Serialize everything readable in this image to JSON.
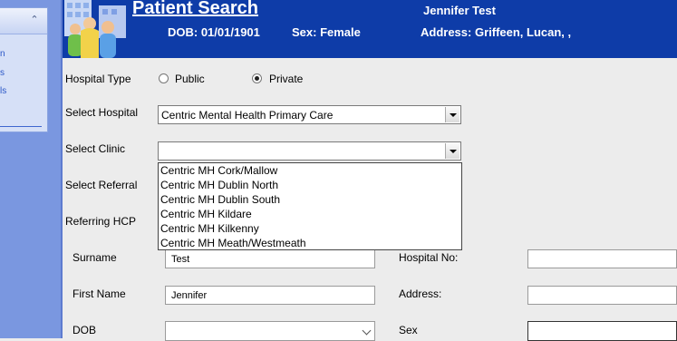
{
  "sidebar": {
    "links": [
      "n",
      "s",
      "ls"
    ]
  },
  "header": {
    "title": "Patient Search",
    "patient_name": "Jennifer Test",
    "dob": "DOB: 01/01/1901",
    "sex": "Sex: Female",
    "address": "Address: Griffeen, Lucan, ,"
  },
  "form": {
    "hospital_type_label": "Hospital Type",
    "public_label": "Public",
    "private_label": "Private",
    "hospital_type_selected": "Private",
    "select_hospital_label": "Select Hospital",
    "select_hospital_value": "Centric Mental Health Primary Care",
    "select_clinic_label": "Select Clinic",
    "select_clinic_value": "",
    "select_referral_label": "Select Referral",
    "referring_hcp_label": "Referring HCP",
    "surname_label": "Surname",
    "surname_value": "Test",
    "first_name_label": "First Name",
    "first_name_value": "Jennifer",
    "dob_label": "DOB",
    "dob_value": "",
    "hospital_no_label": "Hospital No:",
    "hospital_no_value": "",
    "address_label": "Address:",
    "address_value": "",
    "sex_label": "Sex",
    "sex_value": ""
  },
  "clinic_options": [
    "Centric MH  Cork/Mallow",
    "Centric MH Dublin North",
    "Centric MH Dublin South",
    "Centric MH Kildare",
    "Centric MH Kilkenny",
    "Centric MH Meath/Westmeath"
  ],
  "colors": {
    "banner": "#0e3ca8",
    "sidebar": "#7a97e0",
    "page_bg": "#ececec"
  }
}
